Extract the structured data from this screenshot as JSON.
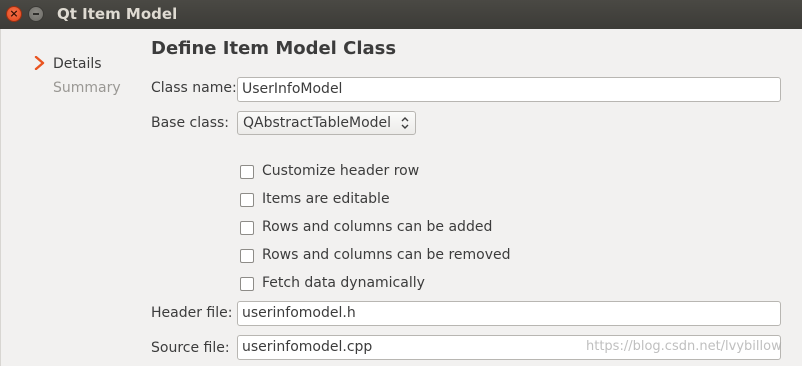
{
  "window": {
    "title": "Qt Item Model",
    "close_glyph": "×"
  },
  "sidebar": {
    "items": [
      {
        "label": "Details",
        "active": true
      },
      {
        "label": "Summary",
        "active": false
      }
    ],
    "current_icon": "chevron-right-icon",
    "accent_color": "#e95420"
  },
  "page": {
    "title": "Define Item Model Class"
  },
  "form": {
    "class_name": {
      "label": "Class name:",
      "value": "UserInfoModel"
    },
    "base_class": {
      "label": "Base class:",
      "value": "QAbstractTableModel"
    },
    "options": [
      {
        "label": "Customize header row",
        "checked": false
      },
      {
        "label": "Items are editable",
        "checked": false
      },
      {
        "label": "Rows and columns can be added",
        "checked": false
      },
      {
        "label": "Rows and columns can be removed",
        "checked": false
      },
      {
        "label": "Fetch data dynamically",
        "checked": false
      }
    ],
    "header_file": {
      "label": "Header file:",
      "value": "userinfomodel.h"
    },
    "source_file": {
      "label": "Source file:",
      "value": "userinfomodel.cpp"
    }
  },
  "watermark": "https://blog.csdn.net/lvybillow"
}
